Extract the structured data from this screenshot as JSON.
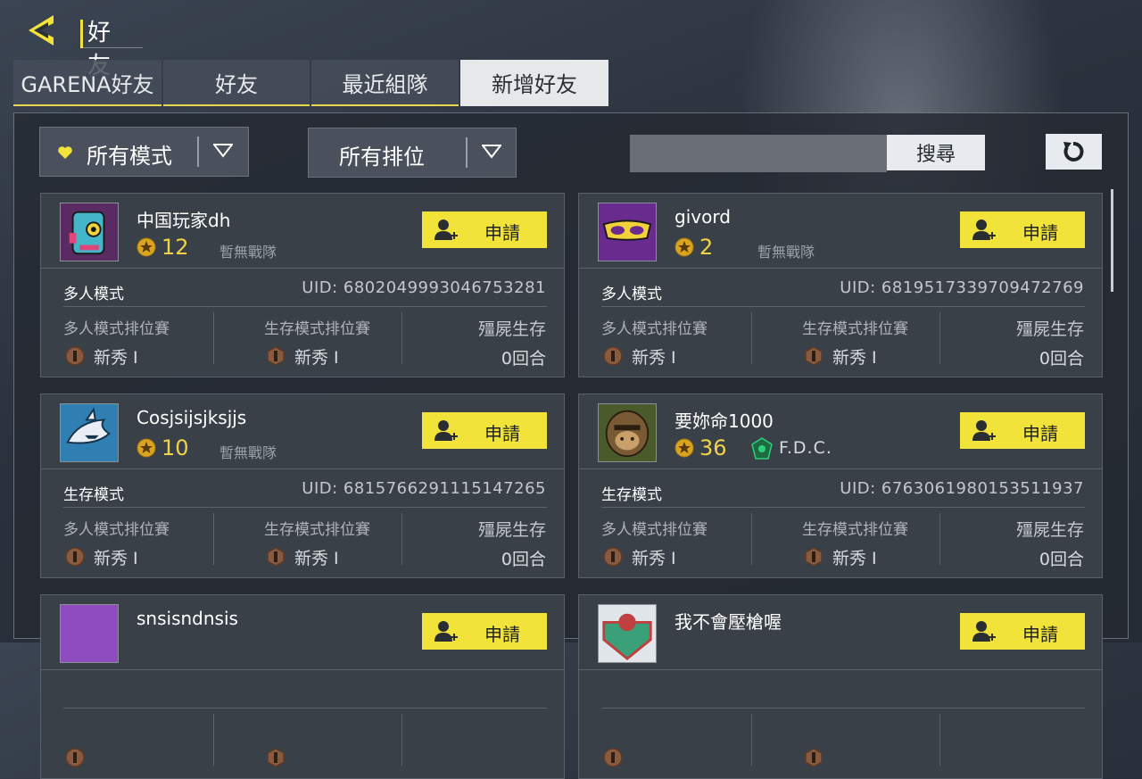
{
  "header": {
    "title": "好友"
  },
  "tabs": [
    {
      "label": "GARENA好友",
      "active": false
    },
    {
      "label": "好友",
      "active": false
    },
    {
      "label": "最近組隊",
      "active": false
    },
    {
      "label": "新增好友",
      "active": true
    }
  ],
  "filters": {
    "mode": "所有模式",
    "rank": "所有排位"
  },
  "search": {
    "value": "",
    "placeholder": "",
    "button": "搜尋"
  },
  "colors": {
    "accent": "#f2e33a",
    "level": "#f1d34a"
  },
  "players": [
    {
      "name": "中国玩家dh",
      "level": "12",
      "clan": "暫無戰隊",
      "clan_icon": false,
      "request": "申請",
      "mode": "多人模式",
      "uid": "UID: 6802049993046753281",
      "c1_label": "多人模式排位賽",
      "c1_rank": "新秀 I",
      "c2_label": "生存模式排位賽",
      "c2_rank": "新秀 I",
      "c3_label": "殭屍生存",
      "c3_value": "0回合",
      "avatar": "robot-avatar"
    },
    {
      "name": "givord",
      "level": "2",
      "clan": "暫無戰隊",
      "clan_icon": false,
      "request": "申請",
      "mode": "多人模式",
      "uid": "UID: 6819517339709472769",
      "c1_label": "多人模式排位賽",
      "c1_rank": "新秀 I",
      "c2_label": "生存模式排位賽",
      "c2_rank": "新秀 I",
      "c3_label": "殭屍生存",
      "c3_value": "0回合",
      "avatar": "mask-avatar"
    },
    {
      "name": "Cosjsijsjksjjs",
      "level": "10",
      "clan": "暫無戰隊",
      "clan_icon": false,
      "request": "申請",
      "mode": "生存模式",
      "uid": "UID: 6815766291115147265",
      "c1_label": "多人模式排位賽",
      "c1_rank": "新秀 I",
      "c2_label": "生存模式排位賽",
      "c2_rank": "新秀 I",
      "c3_label": "殭屍生存",
      "c3_value": "0回合",
      "avatar": "shark-avatar"
    },
    {
      "name": "要妳命1000",
      "level": "36",
      "clan": "F.D.C.",
      "clan_icon": true,
      "request": "申請",
      "mode": "生存模式",
      "uid": "UID: 6763061980153511937",
      "c1_label": "多人模式排位賽",
      "c1_rank": "新秀 I",
      "c2_label": "生存模式排位賽",
      "c2_rank": "新秀 I",
      "c3_label": "殭屍生存",
      "c3_value": "0回合",
      "avatar": "gorilla-avatar"
    },
    {
      "name": "snsisndnsis",
      "level": "",
      "clan": "",
      "clan_icon": false,
      "request": "申請",
      "mode": "",
      "uid": "",
      "c1_label": "",
      "c1_rank": "",
      "c2_label": "",
      "c2_rank": "",
      "c3_label": "",
      "c3_value": "",
      "avatar": "purple-avatar"
    },
    {
      "name": "我不會壓槍喔",
      "level": "",
      "clan": "",
      "clan_icon": false,
      "request": "申請",
      "mode": "",
      "uid": "",
      "c1_label": "",
      "c1_rank": "",
      "c2_label": "",
      "c2_rank": "",
      "c3_label": "",
      "c3_value": "",
      "avatar": "badge-avatar"
    }
  ]
}
